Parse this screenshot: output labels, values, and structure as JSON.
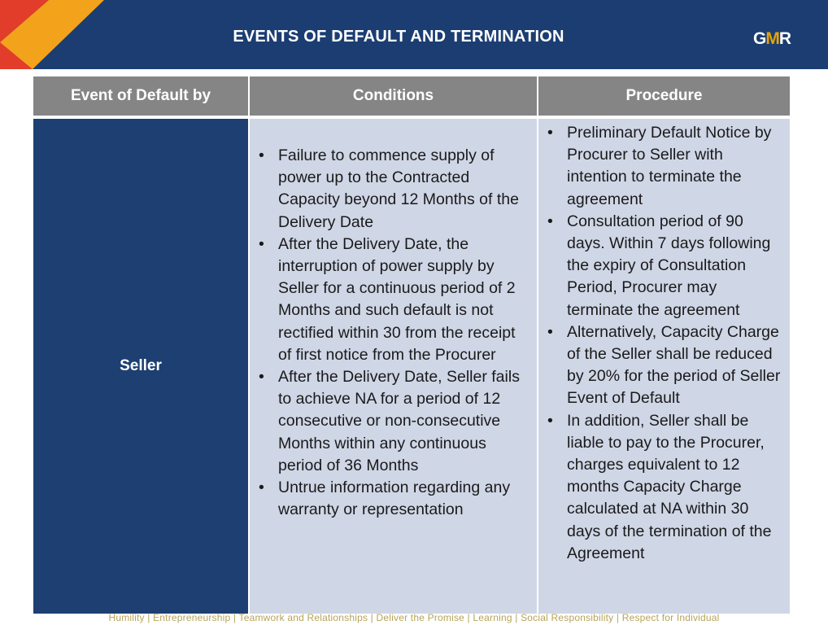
{
  "header": {
    "title": "EVENTS OF DEFAULT AND TERMINATION",
    "brand": {
      "part1": "G",
      "part2": "M",
      "part3": "R"
    },
    "colors": {
      "bar": "#1b3d72",
      "accent_red": "#e23c2a",
      "accent_orange": "#f3a21c"
    }
  },
  "table": {
    "headers": [
      "Event of Default by",
      "Conditions",
      "Procedure"
    ],
    "row": {
      "party": "Seller",
      "conditions": [
        "Failure to commence supply of power up to the Contracted Capacity beyond 12 Months of the Delivery Date",
        "After the Delivery Date, the interruption of power supply by Seller for a continuous period of 2 Months and such default is not rectified within 30 from the receipt of first notice from the Procurer",
        "After the Delivery Date, Seller fails to achieve NA for a period of 12 consecutive or non-consecutive Months within any continuous period of 36 Months",
        "Untrue information regarding any warranty or representation"
      ],
      "procedure": [
        "Preliminary Default Notice by Procurer to Seller with intention to terminate the agreement",
        "Consultation period of 90 days. Within 7 days following the expiry of Consultation Period, Procurer may terminate the agreement",
        "Alternatively, Capacity Charge of the Seller shall be reduced by 20% for the period of Seller Event of Default",
        "In addition, Seller shall be liable to pay to the Procurer, charges equivalent to 12 months Capacity Charge calculated at NA within 30 days of the termination of the Agreement"
      ]
    }
  },
  "footer": {
    "values": "Humility | Entrepreneurship | Teamwork and Relationships | Deliver the Promise | Learning | Social Responsibility | Respect for Individual"
  }
}
